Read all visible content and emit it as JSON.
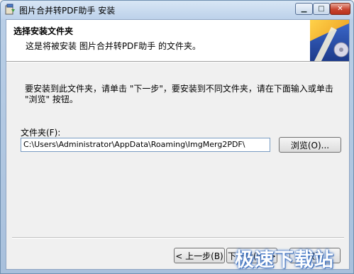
{
  "window": {
    "title": "图片合并转PDF助手 安装",
    "minimize_glyph": "▁",
    "maximize_glyph": "□",
    "close_glyph": "✕"
  },
  "header": {
    "title": "选择安装文件夹",
    "subtitle": "这是将被安装 图片合并转PDF助手 的文件夹。"
  },
  "body": {
    "description": "要安装到此文件夹，请单击 \"下一步\"，要安装到不同文件夹，请在下面输入或单击 \"浏览\" 按钮。",
    "folder_label": "文件夹(F):",
    "folder_path": "C:\\Users\\Administrator\\AppData\\Roaming\\ImgMerg2PDF\\",
    "browse_label": "浏览(O)..."
  },
  "footer": {
    "back_label": "< 上一步(B)",
    "next_label": "下一步(N) >",
    "cancel_label": "取消"
  },
  "watermark": "极速下载站",
  "colors": {
    "title_bar": "#bcd1ea",
    "close_button": "#c8452e",
    "watermark_glow": "#3a72c6"
  }
}
